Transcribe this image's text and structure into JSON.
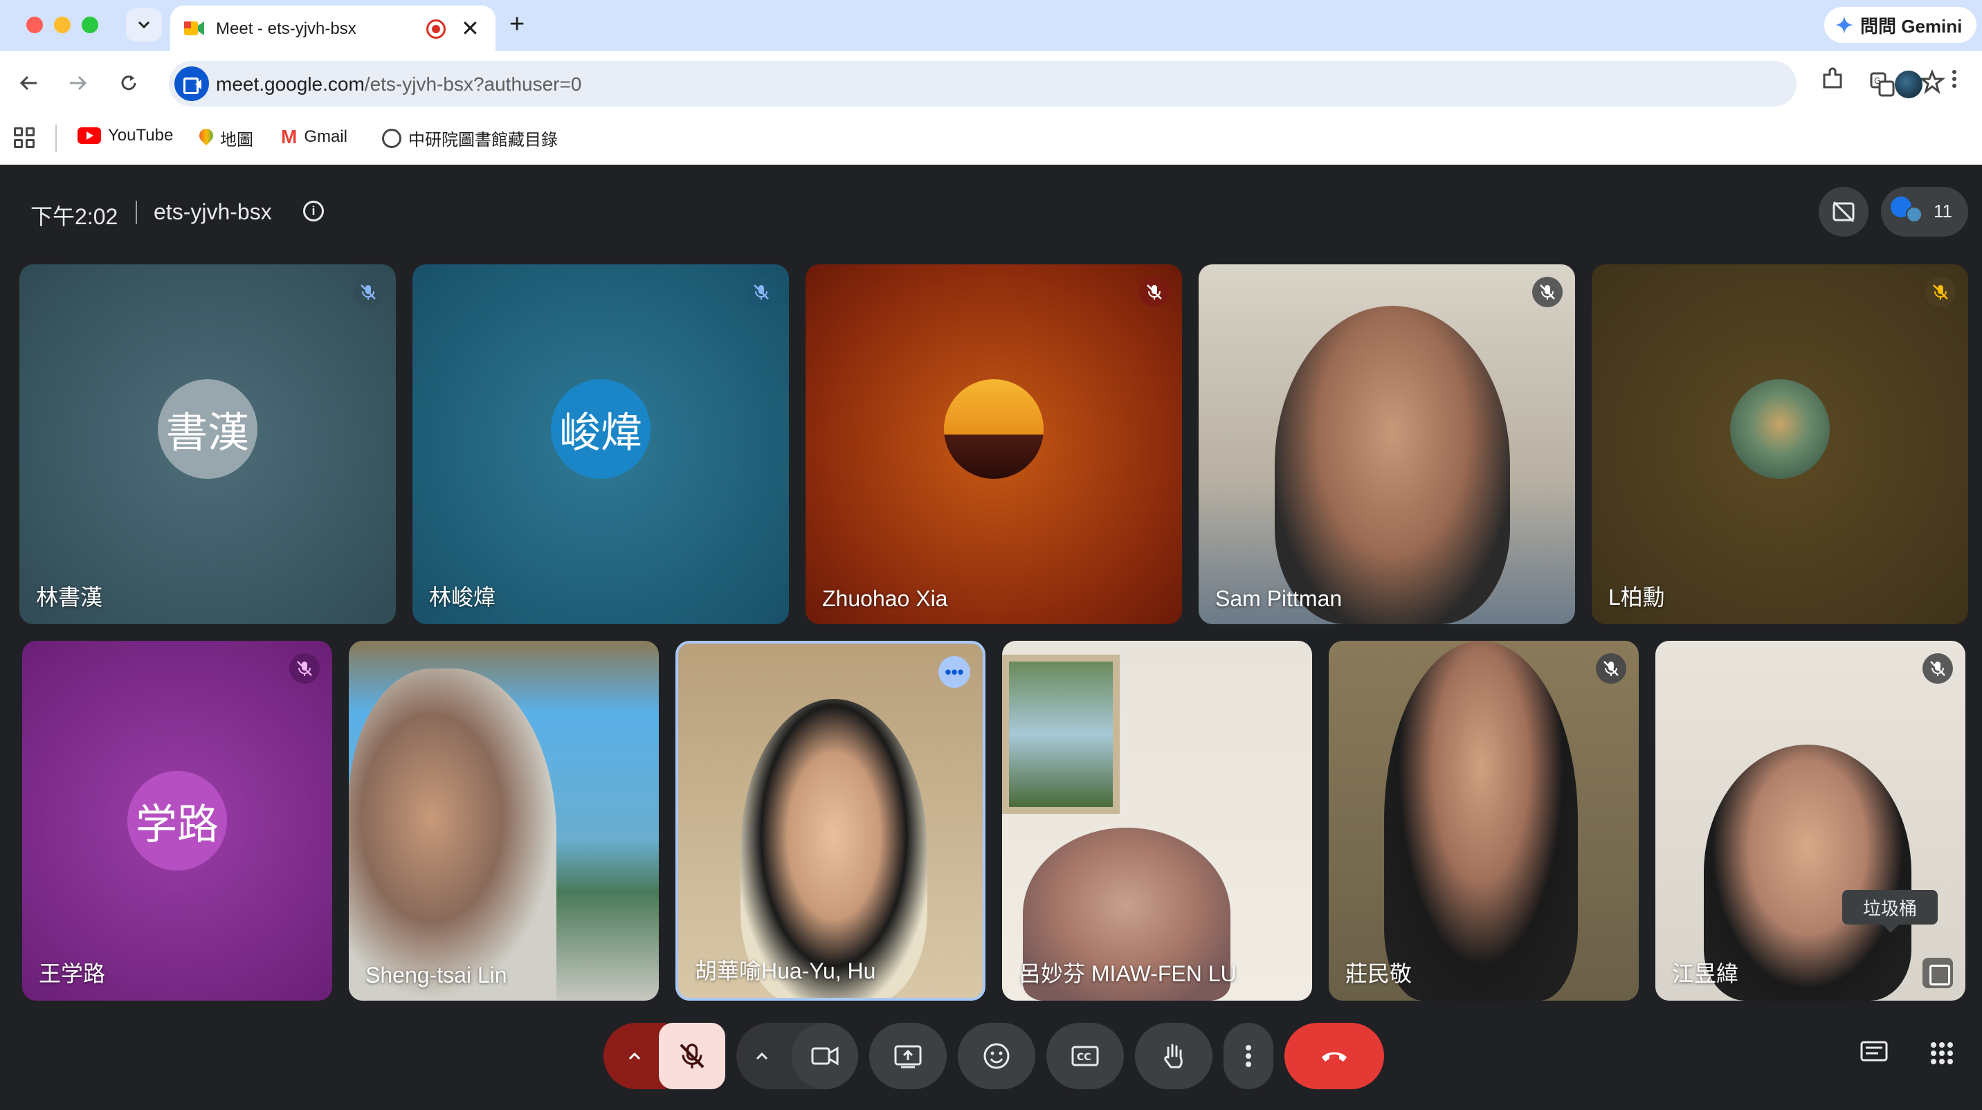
{
  "browser": {
    "tab_title": "Meet - ets-yjvh-bsx",
    "tab_close_icon": "close-icon",
    "new_tab_icon": "plus-icon",
    "gemini_label": "問問 Gemini",
    "url_host": "meet.google.com",
    "url_path": "/ets-yjvh-bsx?authuser=0",
    "bookmarks": [
      {
        "label": "YouTube",
        "icon": "youtube-icon"
      },
      {
        "label": "地圖",
        "icon": "maps-pin-icon"
      },
      {
        "label": "Gmail",
        "icon": "gmail-icon"
      },
      {
        "label": "中研院圖書館藏目錄",
        "icon": "globe-icon"
      }
    ]
  },
  "meet": {
    "time": "下午2:02",
    "meeting_code": "ets-yjvh-bsx",
    "participant_count": "11",
    "tooltip": "垃圾桶"
  },
  "tiles": [
    {
      "name": "林書漢",
      "avatar_text": "書漢",
      "muted": true
    },
    {
      "name": "林峻煒",
      "avatar_text": "峻煒",
      "muted": true
    },
    {
      "name": "Zhuohao Xia",
      "avatar_text": "",
      "muted": true
    },
    {
      "name": "Sam Pittman",
      "avatar_text": "",
      "muted": true
    },
    {
      "name": "L柏勳",
      "avatar_text": "",
      "muted": true
    },
    {
      "name": "王学路",
      "avatar_text": "学路",
      "muted": true
    },
    {
      "name": "Sheng-tsai Lin",
      "avatar_text": "",
      "muted": false
    },
    {
      "name": "胡華喻Hua-Yu, Hu",
      "avatar_text": "",
      "muted": false
    },
    {
      "name": "呂妙芬 MIAW-FEN LU",
      "avatar_text": "",
      "muted": false
    },
    {
      "name": "莊民敬",
      "avatar_text": "",
      "muted": true
    },
    {
      "name": "江昱緯",
      "avatar_text": "",
      "muted": true
    }
  ],
  "colors": {
    "meet_bg": "#202124",
    "end_call": "#e53935",
    "mic_off": "#f9dedc",
    "accent": "#0b57d0"
  }
}
